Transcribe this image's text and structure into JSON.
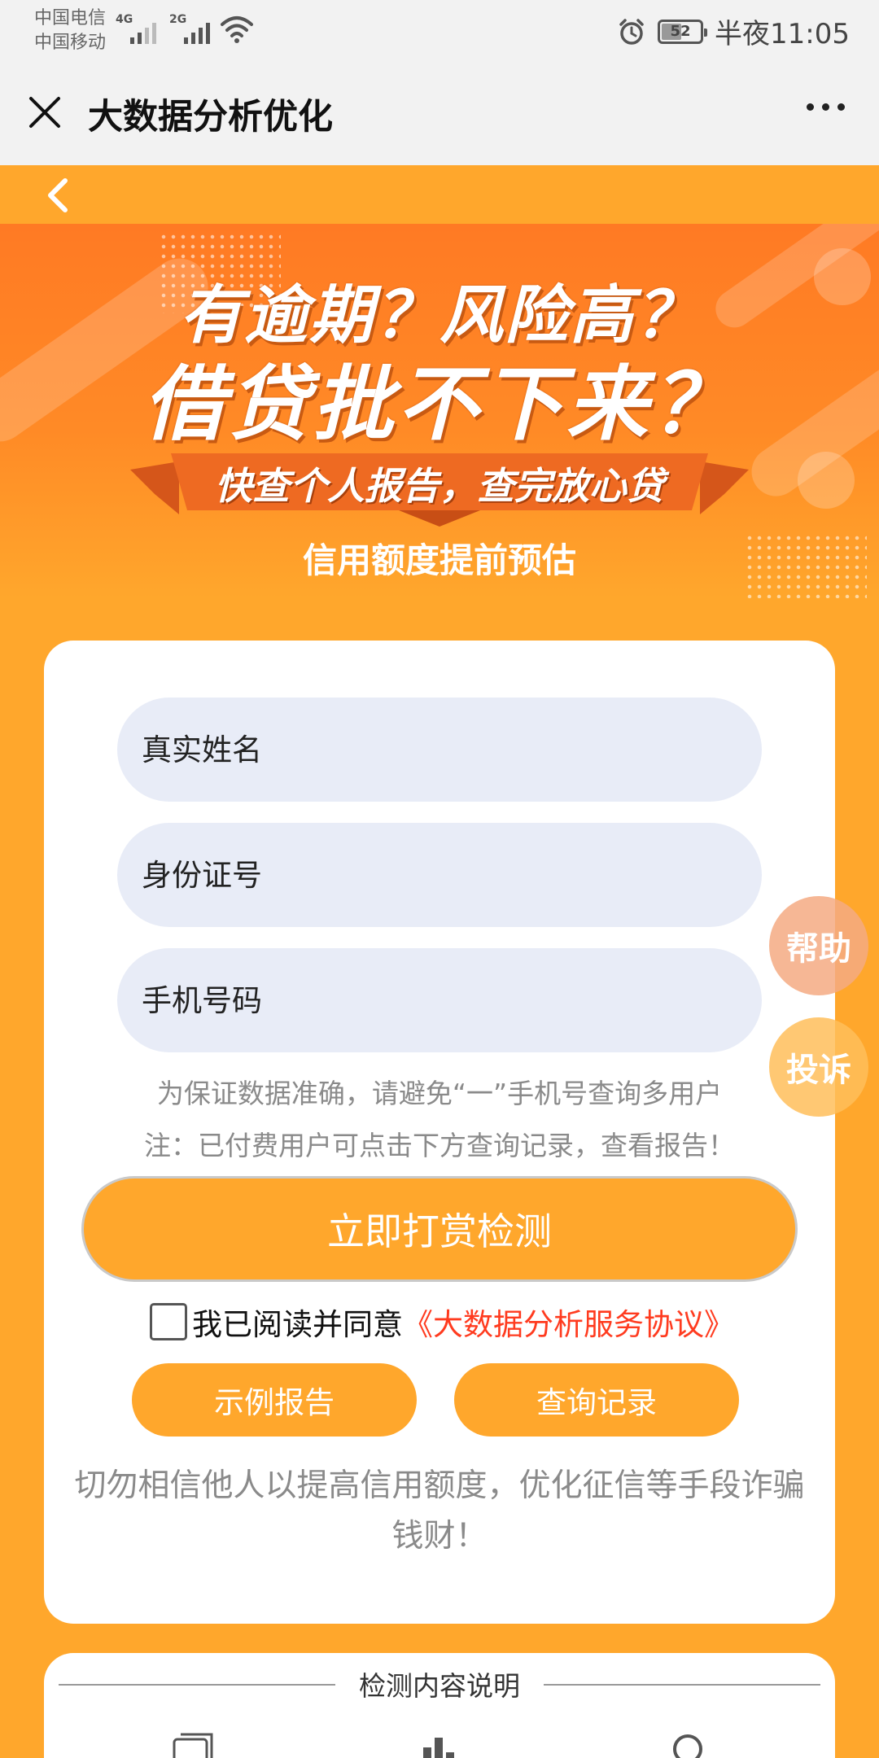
{
  "status_bar": {
    "carrier1": "中国电信",
    "carrier2": "中国移动",
    "net1": "4G",
    "net2": "2G",
    "battery": "52",
    "battery_level": 0.52,
    "time": "半夜11:05"
  },
  "titlebar": {
    "title": "大数据分析优化"
  },
  "banner": {
    "headline1": "有逾期？风险高？",
    "headline2": "借贷批不下来？",
    "ribbon": "快查个人报告，查完放心贷",
    "subtitle": "信用额度提前预估"
  },
  "form": {
    "name_placeholder": "真实姓名",
    "id_placeholder": "身份证号",
    "phone_placeholder": "手机号码",
    "note1": "为保证数据准确，请避免“一”手机号查询多用户",
    "note2": "注：已付费用户可点击下方查询记录，查看报告！",
    "submit_label": "立即打赏检测",
    "agree_text": "我已阅读并同意",
    "agree_link": "《大数据分析服务协议》",
    "sample_label": "示例报告",
    "records_label": "查询记录",
    "warning": "切勿相信他人以提高信用额度，优化征信等手段诈骗钱财！"
  },
  "floating": {
    "help": "帮助",
    "complain": "投诉"
  },
  "detection": {
    "title": "检测内容说明"
  },
  "colors": {
    "accent": "#ffa72c",
    "link": "#ff3b1f",
    "field_bg": "#e8ecf7"
  }
}
